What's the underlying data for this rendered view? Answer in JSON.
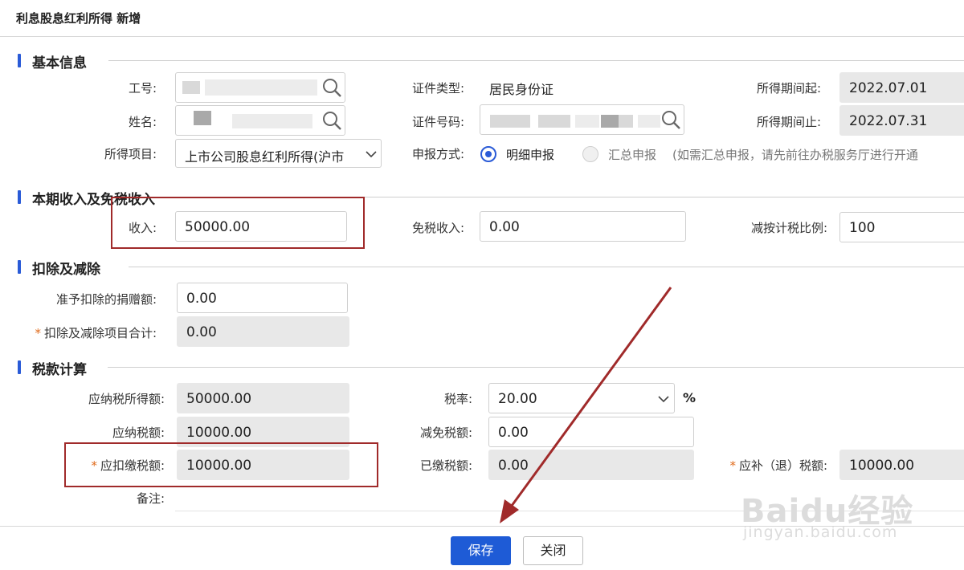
{
  "window": {
    "title": "利息股息红利所得 新增"
  },
  "sections": {
    "basic": "基本信息",
    "income": "本期收入及免税收入",
    "deduction": "扣除及减除",
    "tax": "税款计算"
  },
  "basic": {
    "employee_id_label": "工号:",
    "name_label": "姓名:",
    "income_item_label": "所得项目:",
    "income_item_value": "上市公司股息红利所得(沪市",
    "id_type_label": "证件类型:",
    "id_type_value": "居民身份证",
    "id_number_label": "证件号码:",
    "report_method_label": "申报方式:",
    "report_option_detail": "明细申报",
    "report_option_summary": "汇总申报",
    "report_summary_note": "(如需汇总申报，请先前往办税服务厅进行开通",
    "period_start_label": "所得期间起:",
    "period_start_value": "2022.07.01",
    "period_end_label": "所得期间止:",
    "period_end_value": "2022.07.31"
  },
  "income": {
    "income_label": "收入:",
    "income_value": "50000.00",
    "exempt_label": "免税收入:",
    "exempt_value": "0.00",
    "ratio_label": "减按计税比例:",
    "ratio_value": "100"
  },
  "deduction": {
    "donation_label": "准予扣除的捐赠额:",
    "donation_value": "0.00",
    "total_label": "扣除及减除项目合计:",
    "total_value": "0.00"
  },
  "tax": {
    "taxable_income_label": "应纳税所得额:",
    "taxable_income_value": "50000.00",
    "tax_payable_label": "应纳税额:",
    "tax_payable_value": "10000.00",
    "withholding_label": "应扣缴税额:",
    "withholding_value": "10000.00",
    "rate_label": "税率:",
    "rate_value": "20.00",
    "rate_unit": "%",
    "reduction_label": "减免税额:",
    "reduction_value": "0.00",
    "paid_label": "已缴税额:",
    "paid_value": "0.00",
    "refund_label": "应补（退）税额:",
    "refund_value": "10000.00",
    "remark_label": "备注:"
  },
  "footer": {
    "save": "保存",
    "close": "关闭"
  },
  "watermark": {
    "logo": "Baidu经验",
    "url": "jingyan.baidu.com"
  },
  "colors": {
    "accent": "#2a5bd7",
    "annotation": "#a02a2a",
    "required": "#e06a1b"
  }
}
